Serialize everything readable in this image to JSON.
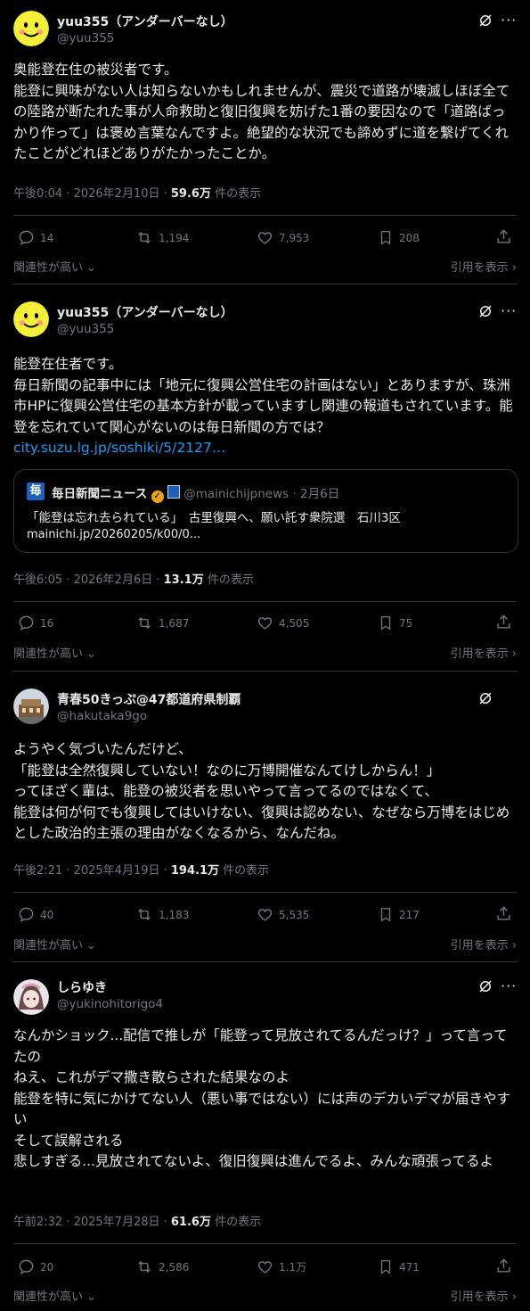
{
  "posts": [
    {
      "name": "yuu355（アンダーバーなし）",
      "handle": "@yuu355",
      "body": "奥能登在住の被災者です。\n能登に興味がない人は知らないかもしれませんが、震災で道路が壊滅しほぼ全ての陸路が断たれた事が人命救助と復旧復興を妨げた1番の要因なので「道路ばっかり作って」は褒め言葉なんですよ。絶望的な状況でも諦めずに道を繋げてくれたことがどれほどありがたかったことか。",
      "time": "午後0:04 · 2026年2月10日 · ",
      "views": "59.6万",
      "views_suffix": " 件の表示",
      "replies": "14",
      "reposts": "1,194",
      "likes": "7,953",
      "bookmarks": "208",
      "relevance": "関連性が高い",
      "quotes": "引用を表示"
    },
    {
      "name": "yuu355（アンダーバーなし）",
      "handle": "@yuu355",
      "body": "能登在住者です。\n毎日新聞の記事中には「地元に復興公営住宅の計画はない」とありますが、珠洲市HPに復興公営住宅の基本方針が載っていますし関連の報道もされています。能登を忘れていて関心がないのは毎日新聞の方では？",
      "link": "city.suzu.lg.jp/soshiki/5/2127…",
      "quote": {
        "logo": "毎",
        "name": "毎日新聞ニュース",
        "handle": "@mainichijpnews · 2月6日",
        "text": "「能登は忘れ去られている」　古里復興へ、願い託す衆院選　石川3区",
        "url": "mainichi.jp/20260205/k00/0..."
      },
      "time": "午後6:05 · 2026年2月6日 · ",
      "views": "13.1万",
      "views_suffix": " 件の表示",
      "replies": "16",
      "reposts": "1,687",
      "likes": "4,505",
      "bookmarks": "75",
      "relevance": "関連性が高い",
      "quotes": "引用を表示"
    },
    {
      "name": "青春50きっぷ@47都道府県制覇",
      "handle": "@hakutaka9go",
      "body": "ようやく気づいたんだけど、\n「能登は全然復興していない！なのに万博開催なんてけしからん！」\nってほざく輩は、能登の被災者を思いやって言ってるのではなくて、\n能登は何が何でも復興してはいけない、復興は認めない、なぜなら万博をはじめとした政治的主張の理由がなくなるから、なんだね。",
      "time": "午後2:21 · 2025年4月19日 · ",
      "views": "194.1万",
      "views_suffix": " 件の表示",
      "replies": "40",
      "reposts": "1,183",
      "likes": "5,535",
      "bookmarks": "217",
      "relevance": "関連性が高い",
      "quotes": "引用を表示"
    },
    {
      "name": "しらゆき",
      "handle": "@yukinohitorigo4",
      "body": "なんかショック...配信で推しが「能登って見放されてるんだっけ？」って言ってたの\nねえ、これがデマ撒き散らされた結果なのよ\n能登を特に気にかけてない人（悪い事ではない）には声のデカいデマが届きやすい\nそして誤解される\n悲しすぎる...見放されてないよ、復旧復興は進んでるよ、みんな頑張ってるよ",
      "time": "午前2:32 · 2025年7月28日 · ",
      "views": "61.6万",
      "views_suffix": " 件の表示",
      "replies": "20",
      "reposts": "2,586",
      "likes": "1.1万",
      "bookmarks": "471",
      "relevance": "関連性が高い",
      "quotes": "引用を表示"
    }
  ],
  "colors": {
    "link": "#1d9bf0",
    "muted": "#71767b",
    "text": "#e7e9ea",
    "verified": "#e8a21a"
  },
  "icons": [
    "grok-icon",
    "more-icon",
    "reply-icon",
    "repost-icon",
    "like-icon",
    "bookmark-icon",
    "share-icon",
    "chevron-down-icon",
    "chevron-right-icon",
    "verified-badge-icon"
  ]
}
